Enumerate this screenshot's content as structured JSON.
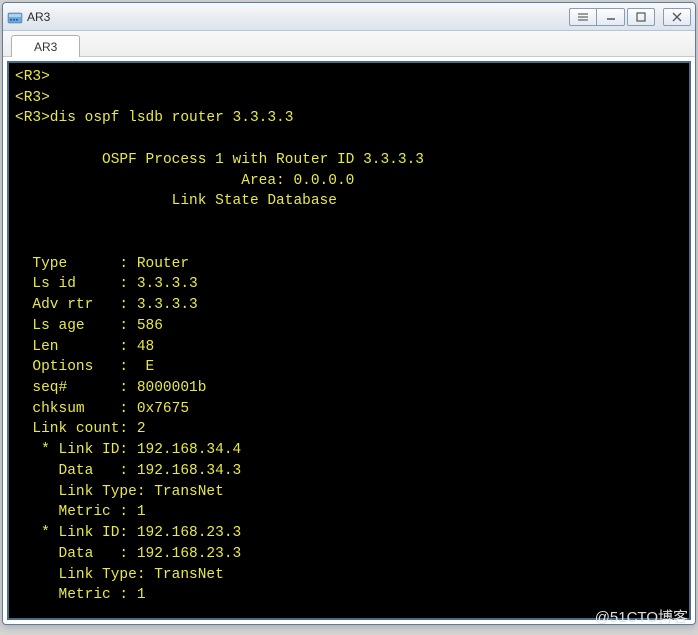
{
  "window": {
    "title": "AR3"
  },
  "tab": {
    "label": "AR3"
  },
  "terminal": {
    "lines": [
      "<R3>",
      "<R3>",
      "<R3>dis ospf lsdb router 3.3.3.3",
      "",
      "\t  OSPF Process 1 with Router ID 3.3.3.3",
      "\t\t\t  Area: 0.0.0.0",
      "\t\t  Link State Database",
      "",
      "",
      "  Type      : Router",
      "  Ls id     : 3.3.3.3",
      "  Adv rtr   : 3.3.3.3",
      "  Ls age    : 586",
      "  Len       : 48",
      "  Options   :  E",
      "  seq#      : 8000001b",
      "  chksum    : 0x7675",
      "  Link count: 2",
      "   * Link ID: 192.168.34.4",
      "     Data   : 192.168.34.3",
      "     Link Type: TransNet",
      "     Metric : 1",
      "   * Link ID: 192.168.23.3",
      "     Data   : 192.168.23.3",
      "     Link Type: TransNet",
      "     Metric : 1"
    ]
  },
  "watermark": "@51CTO博客"
}
